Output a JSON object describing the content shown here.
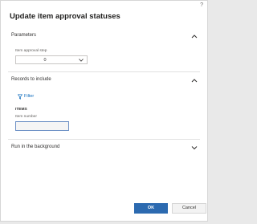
{
  "dialog": {
    "title": "Update item approval statuses",
    "help_icon": "?"
  },
  "sections": {
    "parameters": {
      "label": "Parameters",
      "expanded": true,
      "approval_step": {
        "label": "Item approval step",
        "value": "0"
      }
    },
    "records": {
      "label": "Records to include",
      "expanded": true,
      "filter_label": "Filter",
      "group_label": "ITEMS",
      "item_number": {
        "label": "Item number",
        "value": ""
      }
    },
    "background": {
      "label": "Run in the background",
      "expanded": false
    }
  },
  "footer": {
    "ok_label": "OK",
    "cancel_label": "Cancel"
  },
  "colors": {
    "accent": "#2c6ab0",
    "link": "#0f6cbd"
  },
  "icons": {
    "help": "question-mark",
    "collapse": "chevron-up",
    "expand": "chevron-down",
    "filter": "funnel"
  }
}
